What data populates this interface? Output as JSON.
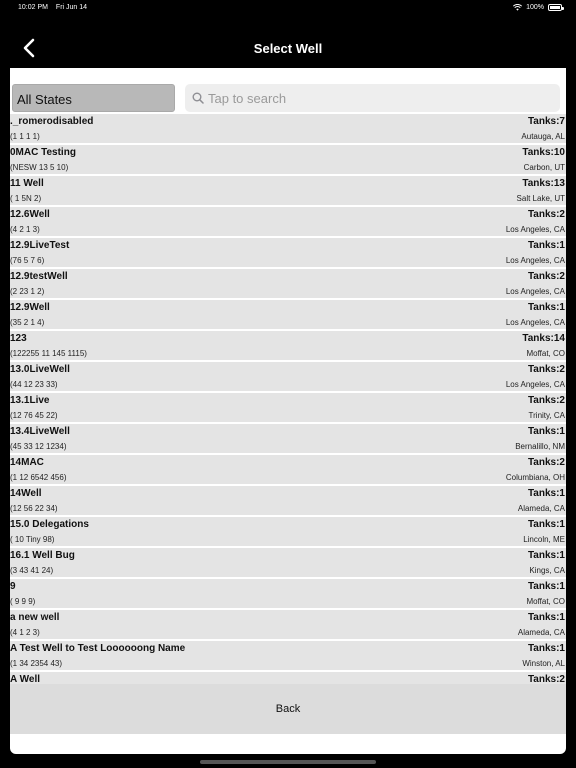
{
  "status_bar": {
    "time": "10:02 PM",
    "date": "Fri Jun 14",
    "battery": "100%",
    "wifi_icon": "wifi-icon",
    "battery_level": 1.0
  },
  "nav": {
    "title": "Select Well",
    "back_icon": "chevron-left-icon"
  },
  "filter": {
    "states_label": "All States",
    "search_placeholder": "Tap to search",
    "search_value": "",
    "search_icon": "search-icon"
  },
  "wells": [
    {
      "name": "._romerodisabled",
      "tanks": "Tanks:7",
      "coords": "(1 1 1 1)",
      "location": "Autauga, AL"
    },
    {
      "name": "0MAC Testing",
      "tanks": "Tanks:10",
      "coords": "(NESW 13 5 10)",
      "location": "Carbon, UT"
    },
    {
      "name": "11 Well",
      "tanks": "Tanks:13",
      "coords": "( 1 5N 2)",
      "location": "Salt Lake, UT"
    },
    {
      "name": "12.6Well",
      "tanks": "Tanks:2",
      "coords": "(4 2 1 3)",
      "location": "Los Angeles, CA"
    },
    {
      "name": "12.9LiveTest",
      "tanks": "Tanks:1",
      "coords": "(76 5 7 6)",
      "location": "Los Angeles, CA"
    },
    {
      "name": "12.9testWell",
      "tanks": "Tanks:2",
      "coords": "(2 23 1 2)",
      "location": "Los Angeles, CA"
    },
    {
      "name": "12.9Well",
      "tanks": "Tanks:1",
      "coords": "(35 2 1 4)",
      "location": "Los Angeles, CA"
    },
    {
      "name": "123",
      "tanks": "Tanks:14",
      "coords": "(122255 11 145 1115)",
      "location": "Moffat, CO"
    },
    {
      "name": "13.0LiveWell",
      "tanks": "Tanks:2",
      "coords": "(44 12 23 33)",
      "location": "Los Angeles, CA"
    },
    {
      "name": "13.1Live",
      "tanks": "Tanks:2",
      "coords": "(12 76 45 22)",
      "location": "Trinity, CA"
    },
    {
      "name": "13.4LiveWell",
      "tanks": "Tanks:1",
      "coords": "(45 33 12 1234)",
      "location": "Bernalillo, NM"
    },
    {
      "name": "14MAC",
      "tanks": "Tanks:2",
      "coords": "(1 12 6542 456)",
      "location": "Columbiana, OH"
    },
    {
      "name": "14Well",
      "tanks": "Tanks:1",
      "coords": "(12 56 22 34)",
      "location": "Alameda, CA"
    },
    {
      "name": "15.0 Delegations",
      "tanks": "Tanks:1",
      "coords": "( 10 Tiny 98)",
      "location": "Lincoln, ME"
    },
    {
      "name": "16.1 Well Bug",
      "tanks": "Tanks:1",
      "coords": "(3 43 41 24)",
      "location": "Kings, CA"
    },
    {
      "name": "9",
      "tanks": "Tanks:1",
      "coords": "( 9 9 9)",
      "location": "Moffat, CO"
    },
    {
      "name": "a new well",
      "tanks": "Tanks:1",
      "coords": "(4 1 2 3)",
      "location": "Alameda, CA"
    },
    {
      "name": "A Test Well to Test Loooooong Name",
      "tanks": "Tanks:1",
      "coords": "(1 34 2354 43)",
      "location": "Winston, AL"
    },
    {
      "name": "A Well",
      "tanks": "Tanks:2",
      "coords": "",
      "location": ""
    }
  ],
  "footer": {
    "back_label": "Back"
  }
}
